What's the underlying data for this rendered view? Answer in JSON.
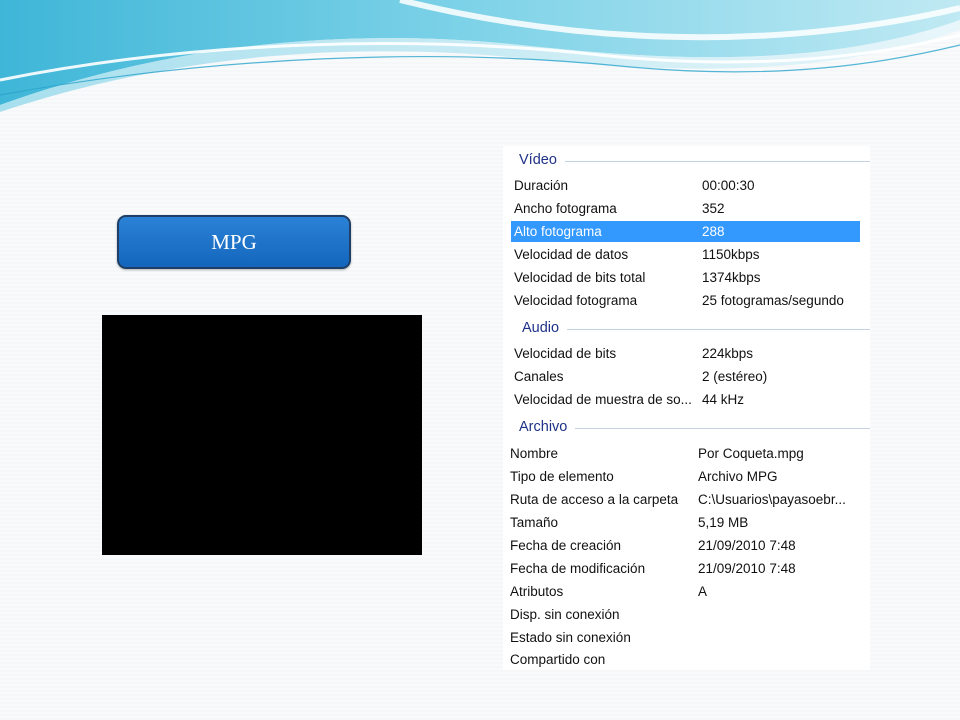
{
  "label": "MPG",
  "colors": {
    "accent": "#1466bd",
    "selection": "#3399ff",
    "section_title": "#1e3287"
  },
  "sections": {
    "video": {
      "title": "Vídeo",
      "rows": [
        {
          "label": "Duración",
          "value": "00:00:30"
        },
        {
          "label": "Ancho fotograma",
          "value": "352"
        },
        {
          "label": "Alto fotograma",
          "value": "288"
        },
        {
          "label": "Velocidad de datos",
          "value": "1150kbps"
        },
        {
          "label": "Velocidad de bits total",
          "value": "1374kbps"
        },
        {
          "label": "Velocidad fotograma",
          "value": "25 fotogramas/segundo"
        }
      ]
    },
    "audio": {
      "title": "Audio",
      "rows": [
        {
          "label": "Velocidad de bits",
          "value": "224kbps"
        },
        {
          "label": "Canales",
          "value": "2 (estéreo)"
        },
        {
          "label": "Velocidad de muestra de so...",
          "value": "44 kHz"
        }
      ]
    },
    "file": {
      "title": "Archivo",
      "rows": [
        {
          "label": "Nombre",
          "value": "Por Coqueta.mpg"
        },
        {
          "label": "Tipo de elemento",
          "value": "Archivo MPG"
        },
        {
          "label": "Ruta de acceso a la carpeta",
          "value": "C:\\Usuarios\\payasoebr..."
        },
        {
          "label": "Tamaño",
          "value": "5,19 MB"
        },
        {
          "label": "Fecha de creación",
          "value": "21/09/2010 7:48"
        },
        {
          "label": "Fecha de modificación",
          "value": "21/09/2010 7:48"
        },
        {
          "label": "Atributos",
          "value": "A"
        },
        {
          "label": "Disp. sin conexión",
          "value": ""
        },
        {
          "label": "Estado sin conexión",
          "value": ""
        },
        {
          "label": "Compartido con",
          "value": ""
        }
      ]
    }
  }
}
